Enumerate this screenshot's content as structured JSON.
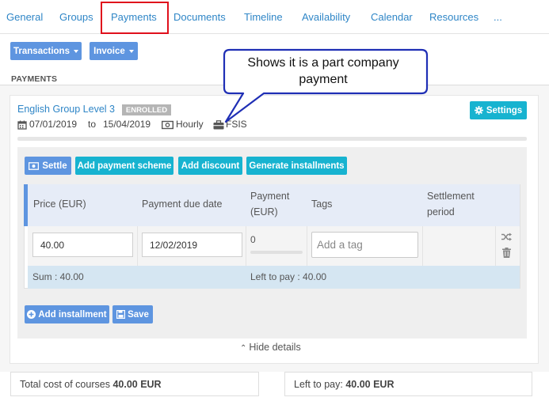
{
  "tabs": [
    {
      "label": "General"
    },
    {
      "label": "Groups"
    },
    {
      "label": "Payments"
    },
    {
      "label": "Documents"
    },
    {
      "label": "Timeline"
    },
    {
      "label": "Availability"
    },
    {
      "label": "Calendar"
    },
    {
      "label": "Resources"
    },
    {
      "label": "..."
    }
  ],
  "toolbar": {
    "transactions_label": "Transactions",
    "invoice_label": "Invoice"
  },
  "section": {
    "title": "PAYMENTS"
  },
  "course": {
    "title": "English Group Level 3",
    "status": "ENROLLED",
    "start_date": "07/01/2019",
    "to_label": "to",
    "end_date": "15/04/2019",
    "rate_type": "Hourly",
    "company": "FSIS",
    "settings_label": "Settings"
  },
  "actions": {
    "settle_label": "Settle",
    "add_scheme_label": "Add payment scheme",
    "add_discount_label": "Add discount",
    "generate_label": "Generate installments"
  },
  "table": {
    "headers": {
      "price": "Price (EUR)",
      "due_date": "Payment due date",
      "payment_line1": "Payment",
      "payment_line2": "(EUR)",
      "tags": "Tags",
      "settlement_line1": "Settlement",
      "settlement_line2": "period"
    },
    "row": {
      "price": "40.00",
      "due_date": "12/02/2019",
      "payment": "0",
      "tag_placeholder": "Add a tag"
    },
    "sum_text": "Sum : 40.00",
    "left_to_pay_text": "Left to pay : 40.00"
  },
  "bottom_actions": {
    "add_installment_label": "Add installment",
    "save_label": "Save"
  },
  "hide_details_label": "Hide details",
  "footer": {
    "total_label": "Total cost of courses",
    "total_value": "40.00 EUR",
    "left_label": "Left to pay:",
    "left_value": "40.00 EUR"
  },
  "callout": {
    "line1": "Shows it is a part company",
    "line2": "payment"
  },
  "colors": {
    "accent_blue": "#5e95e0",
    "teal": "#17b3d0",
    "link": "#2f86c7",
    "highlight_red": "#e0101c",
    "callout_border": "#1f2fb5"
  }
}
